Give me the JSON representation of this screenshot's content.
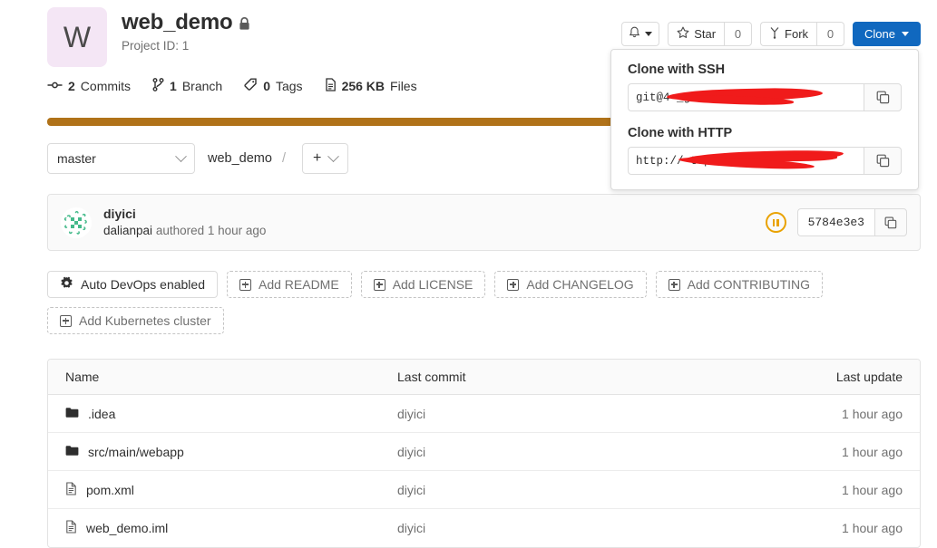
{
  "header": {
    "avatar_letter": "W",
    "project_title": "web_demo",
    "visibility_icon": "lock-icon",
    "project_id": "Project ID: 1"
  },
  "stats": [
    {
      "icon": "commit-icon",
      "count": "2",
      "label": "Commits"
    },
    {
      "icon": "branch-icon",
      "count": "1",
      "label": "Branch"
    },
    {
      "icon": "tag-icon",
      "count": "0",
      "label": "Tags"
    },
    {
      "icon": "file-icon",
      "count": "256 KB",
      "label": "Files"
    }
  ],
  "actions": {
    "notification_icon": "bell-icon",
    "star_label": "Star",
    "star_count": "0",
    "fork_label": "Fork",
    "fork_count": "0",
    "clone_label": "Clone"
  },
  "clone_dropdown": {
    "ssh_label": "Clone with SSH",
    "ssh_value": "git@4                          _grou",
    "http_label": "Clone with HTTP",
    "http_value": "http://                     topch",
    "copy_icon": "copy-icon"
  },
  "language_bar": {
    "color": "#b07219",
    "percent": 100
  },
  "branch_bar": {
    "branch": "master",
    "breadcrumb_root": "web_demo",
    "breadcrumb_sep": "/",
    "add_symbol": "+"
  },
  "commit": {
    "avatar_icon": "identicon-avatar",
    "title": "diyici",
    "author": "dalianpai",
    "meta": "authored 1 hour ago",
    "pipeline_status_icon": "pipeline-pending-icon",
    "sha": "5784e3e3",
    "copy_icon": "copy-icon"
  },
  "add_buttons": [
    {
      "label": "Auto DevOps enabled",
      "icon": "gear-icon",
      "style": "solid"
    },
    {
      "label": "Add README",
      "icon": "plus-square-icon",
      "style": "dashed"
    },
    {
      "label": "Add LICENSE",
      "icon": "plus-square-icon",
      "style": "dashed"
    },
    {
      "label": "Add CHANGELOG",
      "icon": "plus-square-icon",
      "style": "dashed"
    },
    {
      "label": "Add CONTRIBUTING",
      "icon": "plus-square-icon",
      "style": "dashed"
    },
    {
      "label": "Add Kubernetes cluster",
      "icon": "plus-square-icon",
      "style": "dashed"
    }
  ],
  "file_table": {
    "columns": {
      "name": "Name",
      "commit": "Last commit",
      "update": "Last update"
    },
    "rows": [
      {
        "icon": "folder-icon",
        "name": ".idea",
        "commit": "diyici",
        "update": "1 hour ago"
      },
      {
        "icon": "folder-icon",
        "name": "src/main/webapp",
        "commit": "diyici",
        "update": "1 hour ago"
      },
      {
        "icon": "file-doc-icon",
        "name": "pom.xml",
        "commit": "diyici",
        "update": "1 hour ago"
      },
      {
        "icon": "file-doc-icon",
        "name": "web_demo.iml",
        "commit": "diyici",
        "update": "1 hour ago"
      }
    ]
  },
  "colors": {
    "clone_blue": "#1068bf",
    "language_java": "#b07219",
    "pipeline_pending": "#e9a200",
    "avatar_bg": "#f4e6f5",
    "redaction": "#f01b1b"
  }
}
